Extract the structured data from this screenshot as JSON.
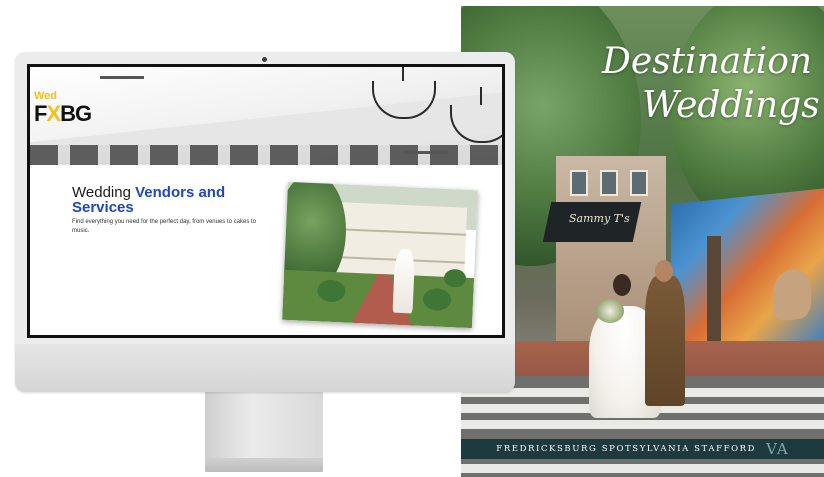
{
  "cover": {
    "title_line1": "Destination",
    "title_line2": "Weddings",
    "shop_sign": "Sammy T's",
    "places": "FREDRICKSBURG  SPOTSYLVANIA  STAFFORD",
    "state": "VA"
  },
  "site": {
    "logo_small": "Wed",
    "logo_big_a": "F",
    "logo_big_x": "X",
    "logo_big_b": "BG",
    "heading_plain": "Wedding",
    "heading_bold": "Vendors and Services",
    "subtitle": "Find everything you need for the perfect day, from venues to cakes to music."
  },
  "colors": {
    "accent_blue": "#1f46c8",
    "logo_yellow": "#f0c21a",
    "band_teal": "#1d3a3f"
  }
}
